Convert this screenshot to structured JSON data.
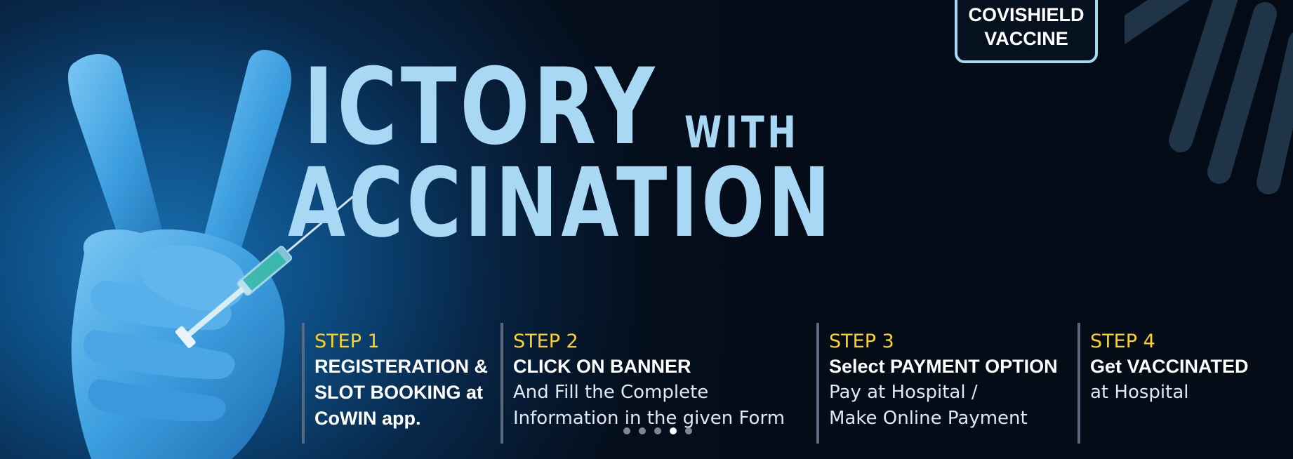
{
  "banner": {
    "headline_line1": "ICTORY",
    "headline_with": "WITH",
    "headline_line2": "ACCINATION",
    "badge_line1": "COVISHIELD",
    "badge_line2": "VACCINE"
  },
  "steps": [
    {
      "title": "STEP 1",
      "bold_line1": "REGISTERATION &",
      "bold_line2": "SLOT BOOKING at",
      "bold_line3": "CoWIN app."
    },
    {
      "title": "STEP 2",
      "bold_line1": "CLICK ON BANNER",
      "text_line1": "And Fill the Complete",
      "text_line2": "Information in the given Form"
    },
    {
      "title": "STEP 3",
      "bold_line1": "Select PAYMENT OPTION",
      "text_line1": "Pay at Hospital /",
      "text_line2": "Make Online Payment"
    },
    {
      "title": "STEP 4",
      "bold_line1": "Get VACCINATED",
      "text_line1": "at Hospital"
    }
  ],
  "carousel": {
    "slide_count": 5,
    "active_index": 3
  },
  "colors": {
    "headline": "#a9d8f5",
    "step_title": "#ffd21f",
    "background_dark": "#050f1e",
    "glove": "#3d9fe0"
  },
  "icons": {
    "hand": "gloved-hand-victory-sign-with-syringe",
    "decor": "diagonal-stripes"
  }
}
